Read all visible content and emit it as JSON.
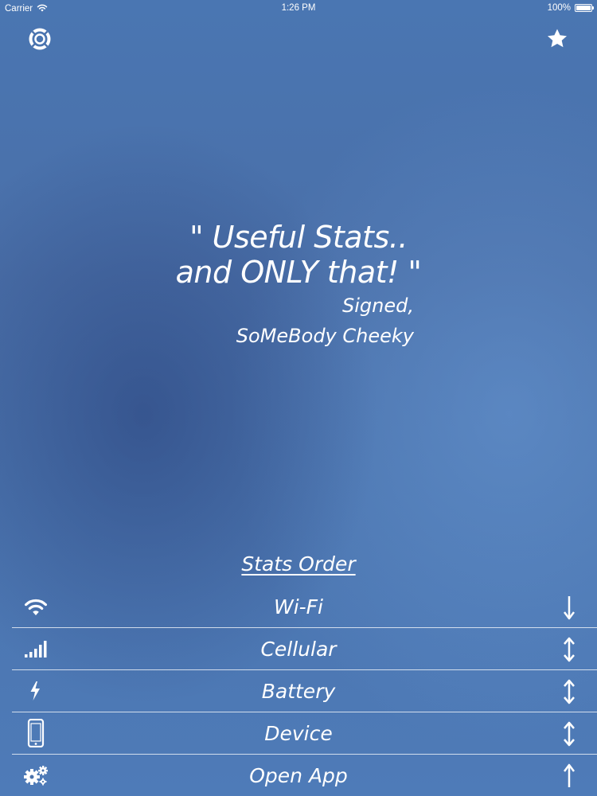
{
  "status_bar": {
    "carrier": "Carrier",
    "time": "1:26 PM",
    "battery": "100%",
    "battery_level": 1.0
  },
  "top_bar": {
    "left_icon": "lifebuoy-icon",
    "right_icon": "star-icon"
  },
  "quote": {
    "line1": "\" Useful Stats..",
    "line2": "and ONLY that! \"",
    "signed": "Signed,",
    "author": "SoMeBody Cheeky"
  },
  "stats_order": {
    "heading": "Stats Order",
    "items": [
      {
        "label": "Wi-Fi",
        "icon": "wifi-icon",
        "arrow": "down-arrow-icon"
      },
      {
        "label": "Cellular",
        "icon": "cellular-signal-icon",
        "arrow": "up-down-arrow-icon"
      },
      {
        "label": "Battery",
        "icon": "lightning-bolt-icon",
        "arrow": "up-down-arrow-icon"
      },
      {
        "label": "Device",
        "icon": "device-icon",
        "arrow": "up-down-arrow-icon"
      },
      {
        "label": "Open App",
        "icon": "gears-icon",
        "arrow": "up-arrow-icon"
      }
    ]
  },
  "colors": {
    "background": "#4a73ae",
    "text": "#ffffff",
    "divider": "#ffffff"
  }
}
